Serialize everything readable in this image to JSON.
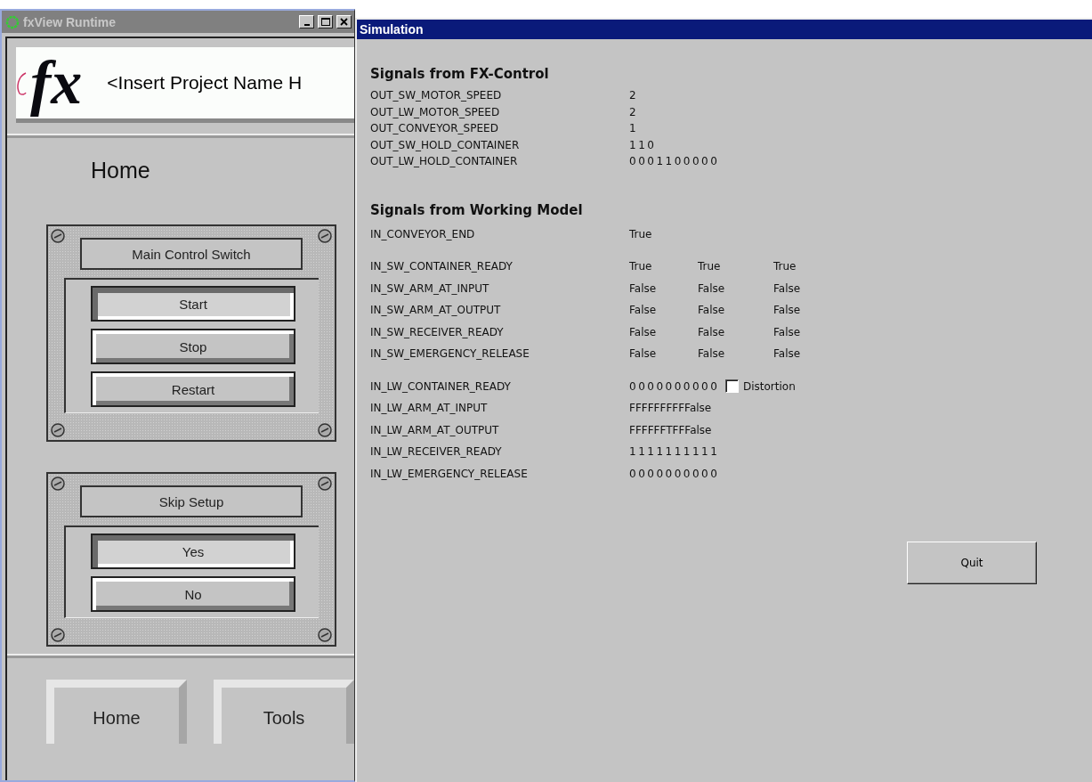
{
  "runtime_window": {
    "title": "fxView Runtime",
    "logo_text": "fx",
    "project_name": "<Insert Project Name H",
    "page_title": "Home",
    "panels": [
      {
        "title": "Main Control Switch",
        "buttons": [
          {
            "label": "Start",
            "selected": true
          },
          {
            "label": "Stop",
            "selected": false
          },
          {
            "label": "Restart",
            "selected": false
          }
        ]
      },
      {
        "title": "Skip Setup",
        "buttons": [
          {
            "label": "Yes",
            "selected": true
          },
          {
            "label": "No",
            "selected": false
          }
        ]
      }
    ],
    "nav_buttons": [
      {
        "label": "Home"
      },
      {
        "label": "Tools"
      }
    ]
  },
  "simulation_window": {
    "title": "Simulation",
    "sections": [
      {
        "heading": "Signals from FX-Control",
        "groups": [
          [
            {
              "name": "OUT_SW_MOTOR_SPEED",
              "values": [
                "2"
              ]
            },
            {
              "name": "OUT_LW_MOTOR_SPEED",
              "values": [
                "2"
              ]
            },
            {
              "name": "OUT_CONVEYOR_SPEED",
              "values": [
                "1"
              ]
            },
            {
              "name": "OUT_SW_HOLD_CONTAINER",
              "values": [
                "110"
              ]
            },
            {
              "name": "OUT_LW_HOLD_CONTAINER",
              "values": [
                "0001100000"
              ]
            }
          ]
        ]
      },
      {
        "heading": "Signals from Working Model",
        "groups": [
          [
            {
              "name": "IN_CONVEYOR_END",
              "values": [
                "True"
              ]
            }
          ],
          [
            {
              "name": "IN_SW_CONTAINER_READY",
              "values": [
                "True",
                "True",
                "True"
              ]
            },
            {
              "name": "IN_SW_ARM_AT_INPUT",
              "values": [
                "False",
                "False",
                "False"
              ]
            },
            {
              "name": "IN_SW_ARM_AT_OUTPUT",
              "values": [
                "False",
                "False",
                "False"
              ]
            },
            {
              "name": "IN_SW_RECEIVER_READY",
              "values": [
                "False",
                "False",
                "False"
              ]
            },
            {
              "name": "IN_SW_EMERGENCY_RELEASE",
              "values": [
                "False",
                "False",
                "False"
              ]
            }
          ],
          [
            {
              "name": "IN_LW_CONTAINER_READY",
              "values": [
                "0000000000"
              ],
              "checkbox": {
                "label": "Distortion",
                "checked": false
              }
            },
            {
              "name": "IN_LW_ARM_AT_INPUT",
              "values": [
                "FFFFFFFFFFalse"
              ]
            },
            {
              "name": "IN_LW_ARM_AT_OUTPUT",
              "values": [
                "FFFFFFTFFFalse"
              ]
            },
            {
              "name": "IN_LW_RECEIVER_READY",
              "values": [
                "1111111111"
              ]
            },
            {
              "name": "IN_LW_EMERGENCY_RELEASE",
              "values": [
                "0000000000"
              ]
            }
          ]
        ]
      }
    ],
    "quit_button": "Quit"
  }
}
